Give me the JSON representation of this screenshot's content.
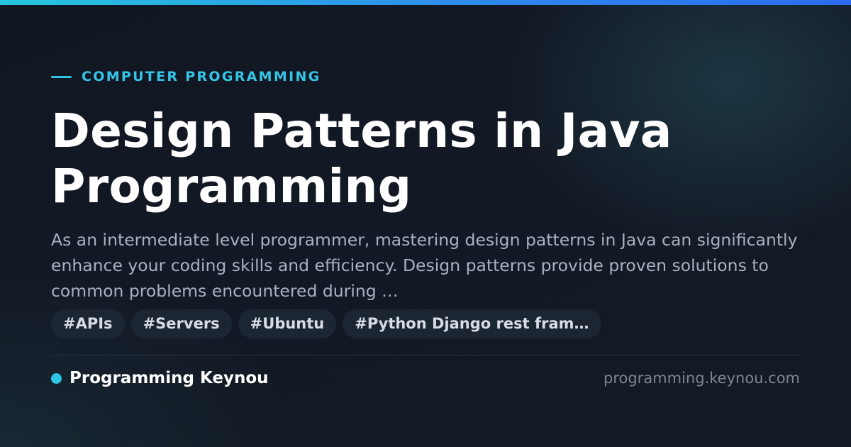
{
  "category": "COMPUTER PROGRAMMING",
  "title": "Design Patterns in Java Programming",
  "summary": "As an intermediate level programmer, mastering design patterns in Java can significantly enhance your coding skills and efficiency. Design patterns provide proven solutions to common problems encountered during …",
  "tags": [
    "#APIs",
    "#Servers",
    "#Ubuntu",
    "#Python Django rest fram…"
  ],
  "brand": {
    "name": "Programming Keynou",
    "url": "programming.keynou.com"
  },
  "colors": {
    "accent": "#2ec4e4",
    "background": "#131924",
    "title": "#ffffff",
    "summary": "#a8b1bf",
    "tag_background": "#1c2632",
    "url": "#7c8694"
  }
}
